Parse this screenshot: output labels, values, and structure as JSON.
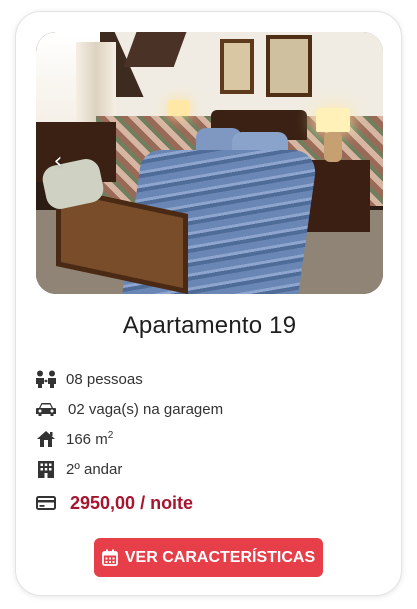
{
  "listing": {
    "title": "Apartamento 19",
    "features": [
      {
        "icon": "people-icon",
        "text": "08 pessoas"
      },
      {
        "icon": "car-icon",
        "text": "02 vaga(s) na garagem"
      },
      {
        "icon": "house-icon",
        "area_value": "166 m",
        "area_unit_sup": "2"
      },
      {
        "icon": "building-icon",
        "text": "2º andar"
      }
    ],
    "price": {
      "icon": "credit-card-icon",
      "text": "2950,00 / noite"
    },
    "cta": {
      "icon": "calendar-icon",
      "label": "VER CARACTERÍSTICAS"
    }
  },
  "carousel": {
    "prev_glyph": "‹"
  },
  "colors": {
    "accent": "#e63f49",
    "price": "#a8142e"
  }
}
